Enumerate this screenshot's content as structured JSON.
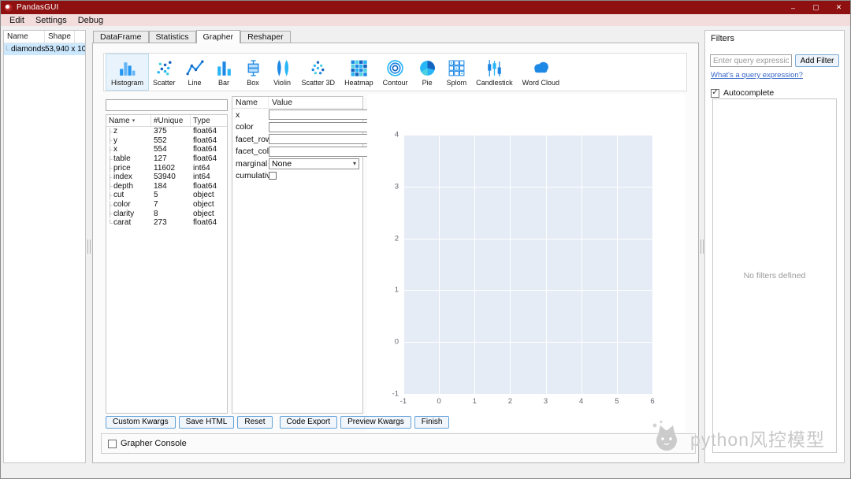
{
  "window": {
    "title": "PandasGUI",
    "menu": [
      "Edit",
      "Settings",
      "Debug"
    ],
    "controls": {
      "minimize": "–",
      "maximize": "▢",
      "close": "✕"
    }
  },
  "icons": {
    "sort_arrow": "▾",
    "dropdown_arrow": "▾",
    "branch": "├",
    "branch_last": "└",
    "check": "✓"
  },
  "nav": {
    "columns": [
      "Name",
      "Shape"
    ],
    "items": [
      {
        "name": "diamonds",
        "shape": "53,940 x 10",
        "selected": true
      }
    ]
  },
  "tabs": [
    {
      "label": "DataFrame",
      "active": false
    },
    {
      "label": "Statistics",
      "active": false
    },
    {
      "label": "Grapher",
      "active": true
    },
    {
      "label": "Reshaper",
      "active": false
    }
  ],
  "plot_types": [
    {
      "label": "Histogram",
      "selected": true
    },
    {
      "label": "Scatter",
      "selected": false
    },
    {
      "label": "Line",
      "selected": false
    },
    {
      "label": "Bar",
      "selected": false
    },
    {
      "label": "Box",
      "selected": false
    },
    {
      "label": "Violin",
      "selected": false
    },
    {
      "label": "Scatter 3D",
      "selected": false
    },
    {
      "label": "Heatmap",
      "selected": false
    },
    {
      "label": "Contour",
      "selected": false
    },
    {
      "label": "Pie",
      "selected": false
    },
    {
      "label": "Splom",
      "selected": false
    },
    {
      "label": "Candlestick",
      "selected": false
    },
    {
      "label": "Word Cloud",
      "selected": false
    }
  ],
  "columns_tree": {
    "search_value": "",
    "headers": [
      "Name",
      "#Unique",
      "Type"
    ],
    "rows": [
      [
        "z",
        "375",
        "float64"
      ],
      [
        "y",
        "552",
        "float64"
      ],
      [
        "x",
        "554",
        "float64"
      ],
      [
        "table",
        "127",
        "float64"
      ],
      [
        "price",
        "11602",
        "int64"
      ],
      [
        "index",
        "53940",
        "int64"
      ],
      [
        "depth",
        "184",
        "float64"
      ],
      [
        "cut",
        "5",
        "object"
      ],
      [
        "color",
        "7",
        "object"
      ],
      [
        "clarity",
        "8",
        "object"
      ],
      [
        "carat",
        "273",
        "float64"
      ]
    ]
  },
  "schema": {
    "headers": [
      "Name",
      "Value"
    ],
    "fields": [
      {
        "name": "x",
        "kind": "text",
        "value": ""
      },
      {
        "name": "color",
        "kind": "text",
        "value": ""
      },
      {
        "name": "facet_row",
        "kind": "text",
        "value": ""
      },
      {
        "name": "facet_col",
        "kind": "text",
        "value": ""
      },
      {
        "name": "marginal",
        "kind": "dropdown",
        "value": "None"
      },
      {
        "name": "cumulative",
        "kind": "checkbox",
        "checked": false
      }
    ]
  },
  "action_buttons": [
    "Custom Kwargs",
    "Save HTML",
    "Reset",
    "Code Export",
    "Preview Kwargs",
    "Finish"
  ],
  "console": {
    "label": "Grapher Console",
    "checked": false
  },
  "filters": {
    "title": "Filters",
    "query_placeholder": "Enter query expression",
    "add_button": "Add Filter",
    "help_link": "What's a query expression?",
    "autocomplete": {
      "label": "Autocomplete",
      "checked": true
    },
    "empty_text": "No filters defined"
  },
  "chart_data": {
    "type": "scatter",
    "series": [],
    "title": "",
    "xlabel": "",
    "ylabel": "",
    "xlim": [
      -1,
      6
    ],
    "ylim": [
      -1,
      4
    ],
    "x_ticks": [
      "-1",
      "0",
      "1",
      "2",
      "3",
      "4",
      "5",
      "6"
    ],
    "y_ticks": [
      "4",
      "3",
      "2",
      "1",
      "0",
      "-1"
    ],
    "grid": true,
    "plot_bg": "#e5ecf6",
    "grid_color": "#ffffff"
  },
  "watermark": {
    "text": "python风控模型"
  },
  "colors": {
    "titlebar": "#8e1010",
    "accent": "#1e88e5",
    "selection": "#cce8ff"
  }
}
